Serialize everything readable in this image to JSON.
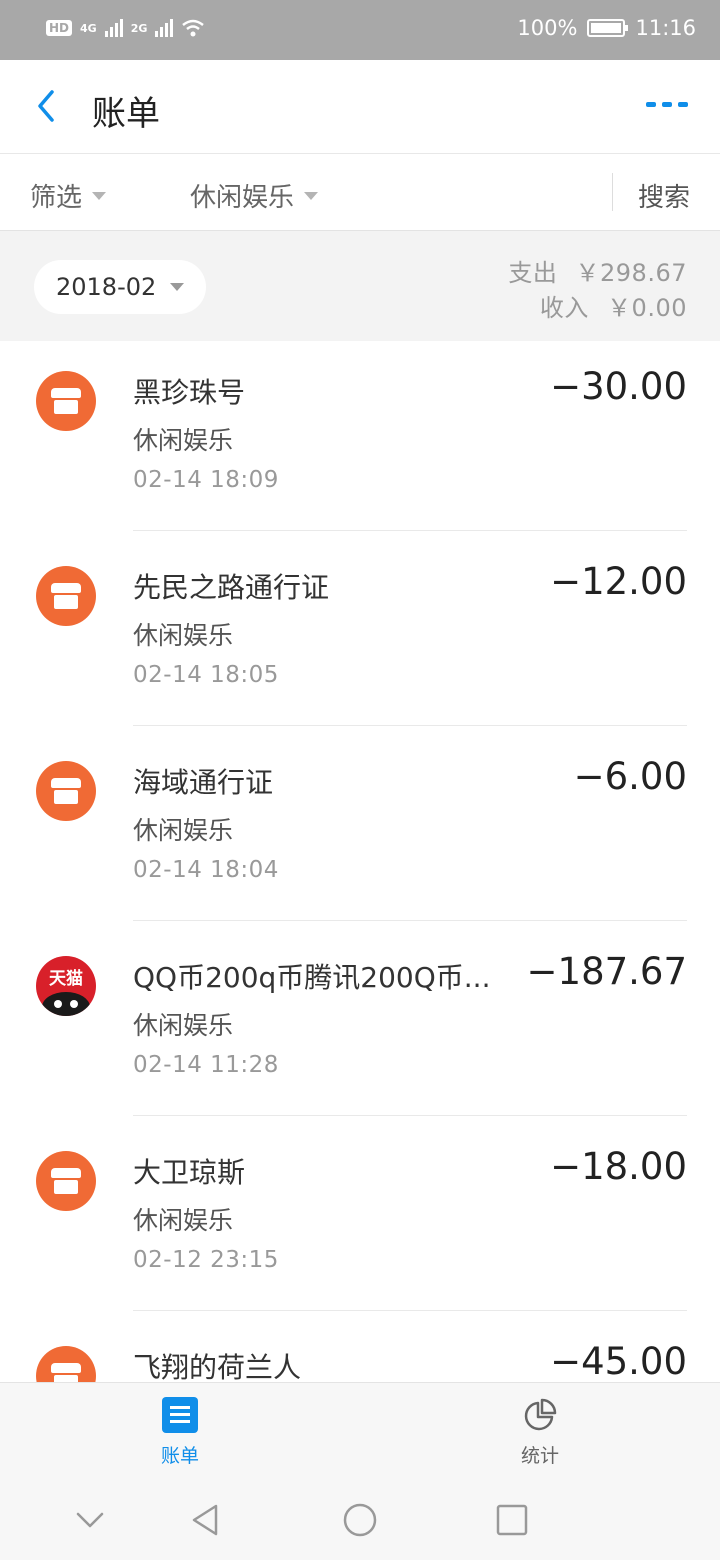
{
  "status_bar": {
    "network_left": "HD",
    "signal_1": "4G",
    "signal_2": "2G",
    "battery_percent": "100%",
    "time": "11:16"
  },
  "header": {
    "title": "账单",
    "back_icon": "chevron-left-icon",
    "more_icon": "more-dots-icon",
    "accent_color": "#108ee9"
  },
  "filter_bar": {
    "filter_label": "筛选",
    "category_label": "休闲娱乐",
    "search_label": "搜索"
  },
  "summary": {
    "month": "2018-02",
    "expense_label": "支出",
    "expense_value": "￥298.67",
    "income_label": "收入",
    "income_value": "￥0.00"
  },
  "transactions": [
    {
      "icon": "store-icon",
      "title": "黑珍珠号",
      "category": "休闲娱乐",
      "time": "02-14  18:09",
      "amount": "−30.00"
    },
    {
      "icon": "store-icon",
      "title": "先民之路通行证",
      "category": "休闲娱乐",
      "time": "02-14  18:05",
      "amount": "−12.00"
    },
    {
      "icon": "store-icon",
      "title": "海域通行证",
      "category": "休闲娱乐",
      "time": "02-14  18:04",
      "amount": "−6.00"
    },
    {
      "icon": "tmall-icon",
      "icon_text": "天猫",
      "title": "QQ币200q币腾讯200Q币...",
      "category": "休闲娱乐",
      "time": "02-14  11:28",
      "amount": "−187.67"
    },
    {
      "icon": "store-icon",
      "title": "大卫琼斯",
      "category": "休闲娱乐",
      "time": "02-12  23:15",
      "amount": "−18.00"
    },
    {
      "icon": "store-icon",
      "title": "飞翔的荷兰人",
      "category": "",
      "time": "",
      "amount": "−45.00"
    }
  ],
  "tabbar": {
    "bills_label": "账单",
    "stats_label": "统计",
    "active": "bills"
  }
}
